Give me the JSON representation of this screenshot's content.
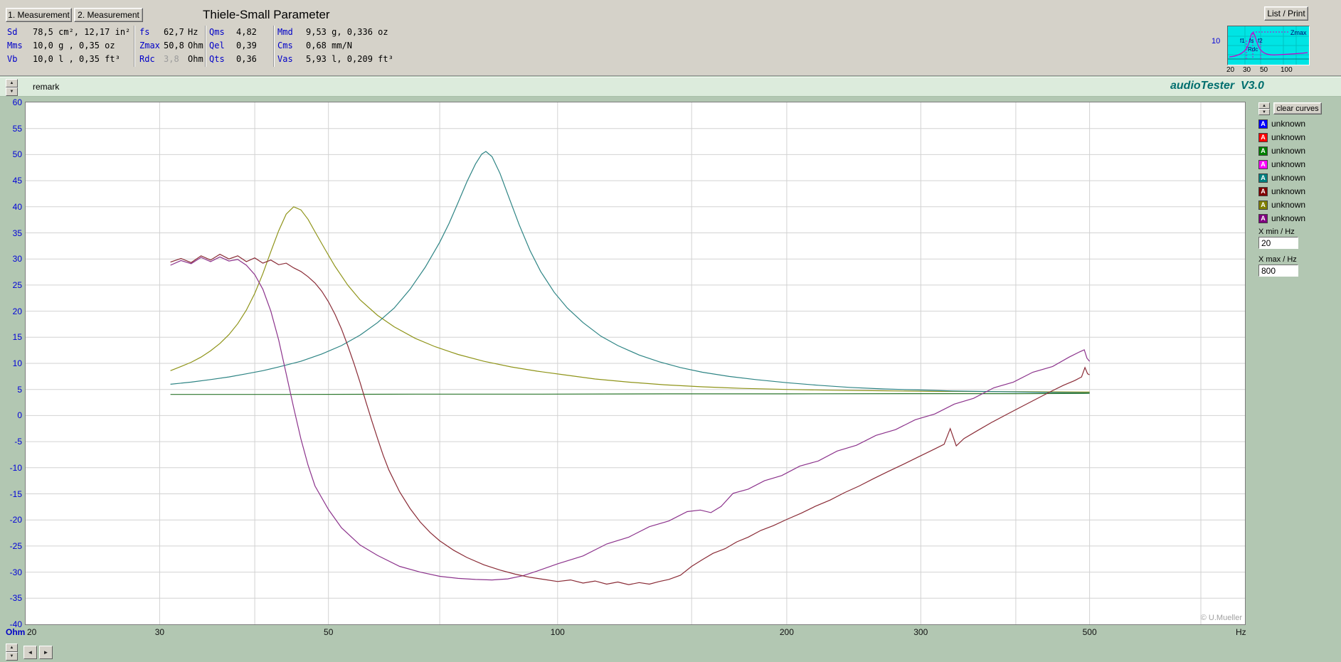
{
  "toolbar": {
    "measurement1_label": "1. Measurement",
    "measurement2_label": "2. Measurement",
    "title": "Thiele-Small Parameter",
    "list_print_label": "List / Print"
  },
  "parameters": {
    "columns": [
      {
        "rows": [
          {
            "label": "Sd",
            "value": "78,5 cm², 12,17 in²"
          },
          {
            "label": "Mms",
            "value": "10,0 g , 0,35 oz"
          },
          {
            "label": "Vb",
            "value": "10,0 l , 0,35 ft³"
          }
        ]
      },
      {
        "rows": [
          {
            "label": "fs",
            "value": "62,7",
            "unit": "Hz"
          },
          {
            "label": "Zmax",
            "value": "50,8",
            "unit": "Ohm"
          },
          {
            "label": "Rdc",
            "value": "3,8",
            "unit": "Ohm",
            "muted": true
          }
        ]
      },
      {
        "rows": [
          {
            "label": "Qms",
            "value": "4,82"
          },
          {
            "label": "Qel",
            "value": "0,39"
          },
          {
            "label": "Qts",
            "value": "0,36"
          }
        ]
      },
      {
        "rows": [
          {
            "label": "Mmd",
            "value": "9,53 g, 0,336 oz"
          },
          {
            "label": "Cms",
            "value": "0,68 mm/N"
          },
          {
            "label": "Vas",
            "value": "5,93 l, 0,209 ft³"
          }
        ]
      }
    ]
  },
  "thumbnail": {
    "labels": {
      "zmax": "Zmax",
      "f1": "f1",
      "fs": "fs",
      "f2": "f2",
      "rdc": "Rdc",
      "y": "10",
      "x_ticks": [
        "20",
        "30",
        "50",
        "100"
      ]
    }
  },
  "remark_bar": {
    "remark": "remark",
    "app_title": "audioTester  V3.0"
  },
  "sidebar": {
    "clear_curves_label": "clear curves",
    "legend": [
      {
        "color": "#0000ff",
        "glyph": "A",
        "label": "unknown"
      },
      {
        "color": "#ff0000",
        "glyph": "A",
        "label": "unknown"
      },
      {
        "color": "#008000",
        "glyph": "A",
        "label": "unknown"
      },
      {
        "color": "#ff00ff",
        "glyph": "A",
        "label": "unknown"
      },
      {
        "color": "#008080",
        "glyph": "A",
        "label": "unknown"
      },
      {
        "color": "#800000",
        "glyph": "A",
        "label": "unknown"
      },
      {
        "color": "#808000",
        "glyph": "A",
        "label": "unknown"
      },
      {
        "color": "#800080",
        "glyph": "A",
        "label": "unknown"
      }
    ],
    "x_min_label": "X min / Hz",
    "x_min_value": "20",
    "x_max_label": "X max / Hz",
    "x_max_value": "800"
  },
  "watermark": "© U.Mueller",
  "icons": {
    "up": "▲",
    "down": "▼",
    "left": "◄",
    "right": "►"
  },
  "chart_data": {
    "type": "line",
    "x_axis": {
      "scale": "log",
      "min": 20,
      "max": 800,
      "unit": "Hz",
      "tick_labels": [
        20,
        30,
        50,
        100,
        200,
        300,
        500
      ],
      "gridlines": [
        30,
        40,
        50,
        70,
        100,
        150,
        200,
        300,
        400,
        500,
        700
      ]
    },
    "y_axis": {
      "min": -40,
      "max": 60,
      "step": 5,
      "unit": "Ohm"
    },
    "grid": true,
    "legend_position": "right-panel",
    "series": [
      {
        "name": "impedance-measurement-1",
        "color": "#8f9419",
        "points": [
          [
            31,
            8.6
          ],
          [
            32,
            9.4
          ],
          [
            33,
            10.2
          ],
          [
            34,
            11.2
          ],
          [
            35,
            12.4
          ],
          [
            36,
            13.8
          ],
          [
            37,
            15.5
          ],
          [
            38,
            17.6
          ],
          [
            39,
            20.2
          ],
          [
            40,
            23.4
          ],
          [
            41,
            27.2
          ],
          [
            42,
            31.4
          ],
          [
            43,
            35.4
          ],
          [
            44,
            38.6
          ],
          [
            45,
            40.0
          ],
          [
            46,
            39.4
          ],
          [
            47,
            37.6
          ],
          [
            48,
            35.2
          ],
          [
            49.5,
            31.8
          ],
          [
            51,
            28.6
          ],
          [
            53,
            25.0
          ],
          [
            55,
            22.2
          ],
          [
            58,
            19.2
          ],
          [
            61,
            17.0
          ],
          [
            65,
            14.8
          ],
          [
            69,
            13.2
          ],
          [
            74,
            11.7
          ],
          [
            80,
            10.4
          ],
          [
            87,
            9.3
          ],
          [
            94,
            8.5
          ],
          [
            102,
            7.8
          ],
          [
            112,
            7.0
          ],
          [
            124,
            6.4
          ],
          [
            138,
            5.9
          ],
          [
            155,
            5.5
          ],
          [
            175,
            5.2
          ],
          [
            200,
            5.0
          ],
          [
            230,
            4.85
          ],
          [
            265,
            4.75
          ],
          [
            305,
            4.65
          ],
          [
            355,
            4.6
          ],
          [
            420,
            4.55
          ],
          [
            500,
            4.5
          ]
        ]
      },
      {
        "name": "impedance-measurement-2",
        "color": "#2d8484",
        "points": [
          [
            31,
            6.0
          ],
          [
            33,
            6.4
          ],
          [
            35,
            6.9
          ],
          [
            37,
            7.4
          ],
          [
            39,
            8.0
          ],
          [
            41,
            8.6
          ],
          [
            43,
            9.3
          ],
          [
            46,
            10.4
          ],
          [
            49,
            11.8
          ],
          [
            52,
            13.4
          ],
          [
            55,
            15.4
          ],
          [
            58,
            17.8
          ],
          [
            61,
            20.6
          ],
          [
            64,
            24.2
          ],
          [
            67,
            28.4
          ],
          [
            70,
            33.2
          ],
          [
            72,
            36.8
          ],
          [
            74,
            40.8
          ],
          [
            76,
            44.8
          ],
          [
            78,
            48.2
          ],
          [
            79.5,
            50.1
          ],
          [
            80.5,
            50.6
          ],
          [
            82,
            49.6
          ],
          [
            84,
            46.4
          ],
          [
            86,
            42.4
          ],
          [
            89,
            36.6
          ],
          [
            92,
            31.6
          ],
          [
            95,
            27.6
          ],
          [
            99,
            23.6
          ],
          [
            103,
            20.6
          ],
          [
            108,
            17.8
          ],
          [
            114,
            15.2
          ],
          [
            120,
            13.4
          ],
          [
            128,
            11.6
          ],
          [
            136,
            10.3
          ],
          [
            145,
            9.2
          ],
          [
            155,
            8.3
          ],
          [
            168,
            7.5
          ],
          [
            182,
            6.9
          ],
          [
            200,
            6.3
          ],
          [
            220,
            5.8
          ],
          [
            242,
            5.4
          ],
          [
            268,
            5.1
          ],
          [
            298,
            4.9
          ],
          [
            330,
            4.7
          ],
          [
            368,
            4.6
          ],
          [
            410,
            4.5
          ],
          [
            455,
            4.4
          ],
          [
            500,
            4.35
          ]
        ]
      },
      {
        "name": "resistance-flat",
        "color": "#2a752a",
        "points": [
          [
            31,
            4.05
          ],
          [
            45,
            4.05
          ],
          [
            65,
            4.1
          ],
          [
            95,
            4.1
          ],
          [
            140,
            4.15
          ],
          [
            200,
            4.15
          ],
          [
            290,
            4.2
          ],
          [
            400,
            4.2
          ],
          [
            500,
            4.25
          ]
        ]
      },
      {
        "name": "phase-measurement-1",
        "color": "#8c338c",
        "points": [
          [
            31,
            28.8
          ],
          [
            32,
            29.7
          ],
          [
            33,
            29.1
          ],
          [
            34,
            30.3
          ],
          [
            35,
            29.5
          ],
          [
            36,
            30.4
          ],
          [
            37,
            29.6
          ],
          [
            38,
            29.9
          ],
          [
            39,
            28.8
          ],
          [
            40,
            27.0
          ],
          [
            41,
            24.2
          ],
          [
            42,
            20.0
          ],
          [
            43,
            14.5
          ],
          [
            44,
            8.0
          ],
          [
            45,
            1.5
          ],
          [
            46,
            -4.5
          ],
          [
            47,
            -9.5
          ],
          [
            48,
            -13.5
          ],
          [
            50,
            -18.0
          ],
          [
            52,
            -21.5
          ],
          [
            55,
            -24.8
          ],
          [
            58,
            -26.8
          ],
          [
            62,
            -28.9
          ],
          [
            66,
            -30.0
          ],
          [
            70,
            -30.8
          ],
          [
            74,
            -31.2
          ],
          [
            78,
            -31.4
          ],
          [
            82,
            -31.5
          ],
          [
            86,
            -31.3
          ],
          [
            90,
            -30.7
          ],
          [
            94,
            -29.8
          ],
          [
            100,
            -28.4
          ],
          [
            108,
            -26.9
          ],
          [
            116,
            -24.6
          ],
          [
            124,
            -23.3
          ],
          [
            132,
            -21.3
          ],
          [
            140,
            -20.2
          ],
          [
            148,
            -18.4
          ],
          [
            154,
            -18.1
          ],
          [
            159,
            -18.6
          ],
          [
            164,
            -17.4
          ],
          [
            170,
            -14.9
          ],
          [
            178,
            -14.1
          ],
          [
            187,
            -12.5
          ],
          [
            197,
            -11.5
          ],
          [
            208,
            -9.7
          ],
          [
            220,
            -8.7
          ],
          [
            233,
            -6.8
          ],
          [
            247,
            -5.7
          ],
          [
            262,
            -3.8
          ],
          [
            278,
            -2.7
          ],
          [
            295,
            -0.8
          ],
          [
            313,
            0.3
          ],
          [
            332,
            2.2
          ],
          [
            352,
            3.3
          ],
          [
            374,
            5.3
          ],
          [
            397,
            6.4
          ],
          [
            421,
            8.3
          ],
          [
            447,
            9.4
          ],
          [
            470,
            11.2
          ],
          [
            485,
            12.2
          ],
          [
            492,
            12.6
          ],
          [
            496,
            11.0
          ],
          [
            500,
            10.4
          ]
        ]
      },
      {
        "name": "phase-measurement-2",
        "color": "#8a2b36",
        "points": [
          [
            31,
            29.4
          ],
          [
            32,
            30.1
          ],
          [
            33,
            29.3
          ],
          [
            34,
            30.6
          ],
          [
            35,
            29.8
          ],
          [
            36,
            30.9
          ],
          [
            37,
            30.0
          ],
          [
            38,
            30.6
          ],
          [
            39,
            29.5
          ],
          [
            40,
            30.2
          ],
          [
            41,
            29.2
          ],
          [
            42,
            29.8
          ],
          [
            43,
            28.9
          ],
          [
            44,
            29.2
          ],
          [
            45,
            28.3
          ],
          [
            46,
            27.6
          ],
          [
            47,
            26.6
          ],
          [
            48,
            25.4
          ],
          [
            49,
            23.8
          ],
          [
            50,
            21.8
          ],
          [
            51,
            19.4
          ],
          [
            52,
            16.6
          ],
          [
            53,
            13.4
          ],
          [
            54,
            10.0
          ],
          [
            55,
            6.4
          ],
          [
            56,
            2.6
          ],
          [
            57,
            -1.0
          ],
          [
            58,
            -4.4
          ],
          [
            59,
            -7.6
          ],
          [
            60,
            -10.4
          ],
          [
            62,
            -14.6
          ],
          [
            64,
            -17.8
          ],
          [
            66,
            -20.4
          ],
          [
            68,
            -22.4
          ],
          [
            70,
            -24.0
          ],
          [
            73,
            -25.8
          ],
          [
            76,
            -27.2
          ],
          [
            80,
            -28.6
          ],
          [
            84,
            -29.6
          ],
          [
            88,
            -30.4
          ],
          [
            92,
            -31.0
          ],
          [
            96,
            -31.4
          ],
          [
            100,
            -31.8
          ],
          [
            104,
            -31.5
          ],
          [
            108,
            -32.1
          ],
          [
            112,
            -31.7
          ],
          [
            116,
            -32.3
          ],
          [
            120,
            -31.9
          ],
          [
            124,
            -32.4
          ],
          [
            128,
            -32.0
          ],
          [
            132,
            -32.3
          ],
          [
            136,
            -31.8
          ],
          [
            140,
            -31.4
          ],
          [
            145,
            -30.6
          ],
          [
            150,
            -28.9
          ],
          [
            155,
            -27.6
          ],
          [
            160,
            -26.4
          ],
          [
            166,
            -25.5
          ],
          [
            172,
            -24.2
          ],
          [
            178,
            -23.3
          ],
          [
            185,
            -22.0
          ],
          [
            192,
            -21.1
          ],
          [
            200,
            -19.9
          ],
          [
            209,
            -18.7
          ],
          [
            218,
            -17.4
          ],
          [
            228,
            -16.2
          ],
          [
            238,
            -14.8
          ],
          [
            249,
            -13.5
          ],
          [
            260,
            -12.1
          ],
          [
            272,
            -10.7
          ],
          [
            285,
            -9.3
          ],
          [
            298,
            -7.9
          ],
          [
            312,
            -6.5
          ],
          [
            322,
            -5.5
          ],
          [
            328,
            -2.5
          ],
          [
            334,
            -5.8
          ],
          [
            342,
            -4.4
          ],
          [
            356,
            -2.9
          ],
          [
            372,
            -1.3
          ],
          [
            389,
            0.2
          ],
          [
            407,
            1.7
          ],
          [
            426,
            3.2
          ],
          [
            446,
            4.7
          ],
          [
            462,
            5.8
          ],
          [
            478,
            6.7
          ],
          [
            488,
            7.4
          ],
          [
            493,
            9.2
          ],
          [
            497,
            8.0
          ],
          [
            500,
            7.8
          ]
        ]
      }
    ]
  }
}
